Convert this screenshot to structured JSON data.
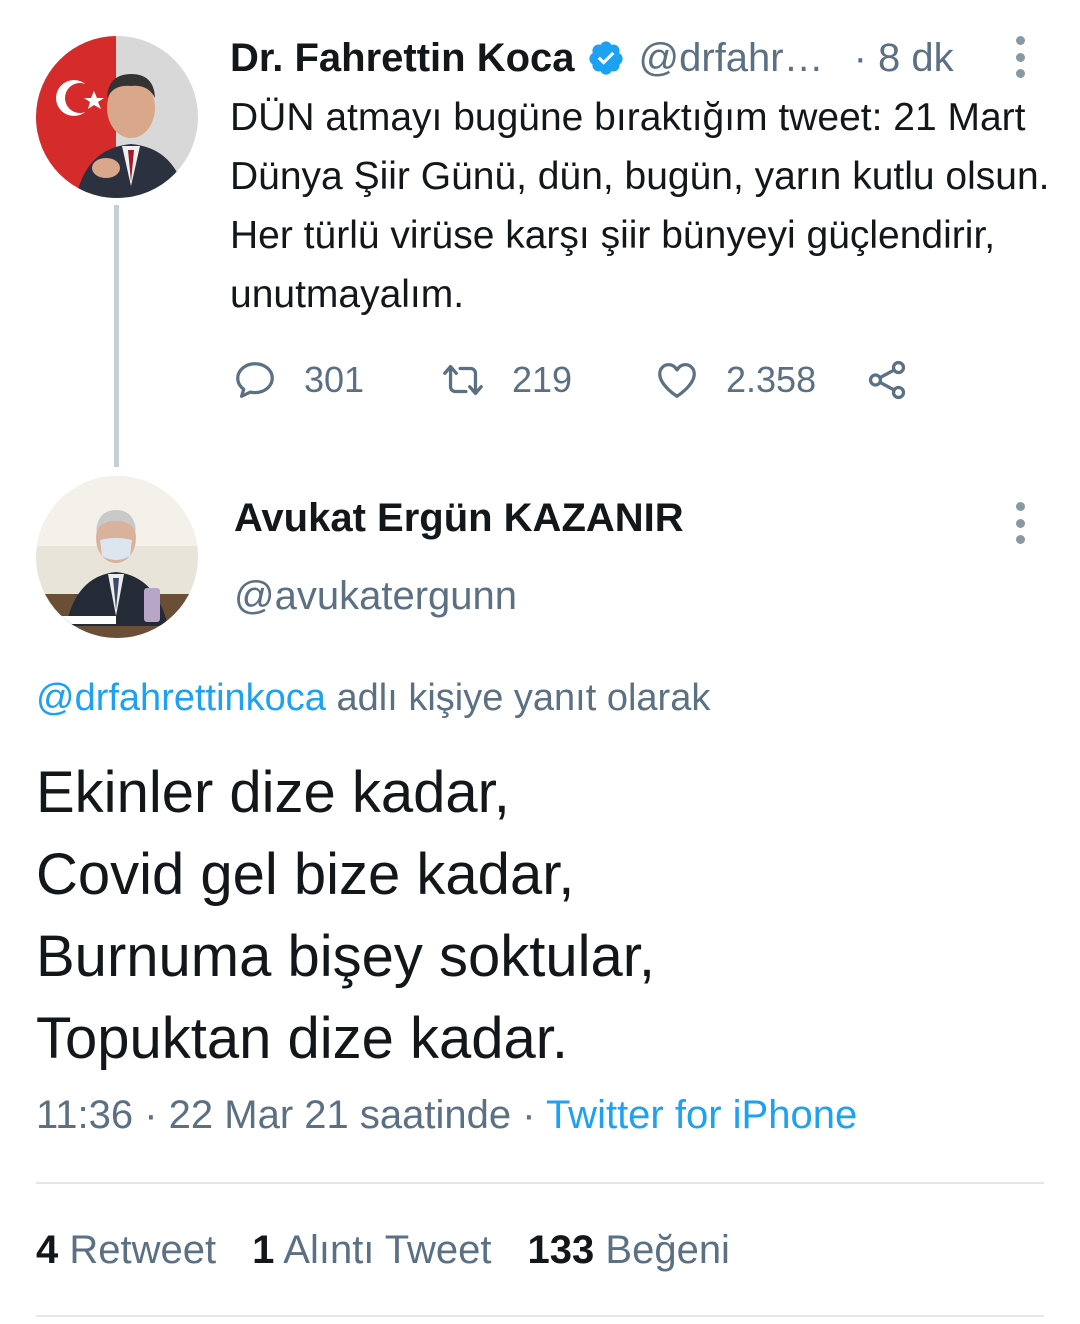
{
  "parent": {
    "author_name": "Dr. Fahrettin Koca",
    "handle": "@drfahr…",
    "time": "· 8 dk",
    "text": "DÜN atmayı bugüne bıraktığım tweet: 21 Mart Dünya Şiir Günü, dün, bugün, yarın kutlu olsun. Her türlü virüse karşı şiir bünyeyi güçlendirir, unutmayalım.",
    "replies": "301",
    "retweets": "219",
    "likes": "2.358",
    "icons": [
      "verified-badge-icon",
      "reply-icon",
      "retweet-icon",
      "like-icon",
      "share-icon",
      "more-icon"
    ]
  },
  "reply": {
    "author_name": "Avukat Ergün KAZANIR",
    "handle": "@avukatergunn",
    "replying_to_handle": "@drfahrettinkoca",
    "replying_to_suffix": " adlı kişiye yanıt olarak",
    "lines": [
      "Ekinler dize kadar,",
      "Covid gel bize kadar,",
      "Burnuma bişey soktular,",
      "Topuktan dize kadar."
    ],
    "time_date": "11:36 · 22 Mar 21 saatinde · ",
    "source": "Twitter for iPhone",
    "stats": {
      "retweet_count": "4",
      "retweet_label": " Retweet",
      "quote_count": "1",
      "quote_label": " Alıntı Tweet",
      "like_count": "133",
      "like_label": " Beğeni"
    }
  },
  "colors": {
    "accent": "#1da1f2",
    "secondary_text": "#5b7083",
    "primary_text": "#14171a",
    "divider": "#e1e8ed"
  }
}
